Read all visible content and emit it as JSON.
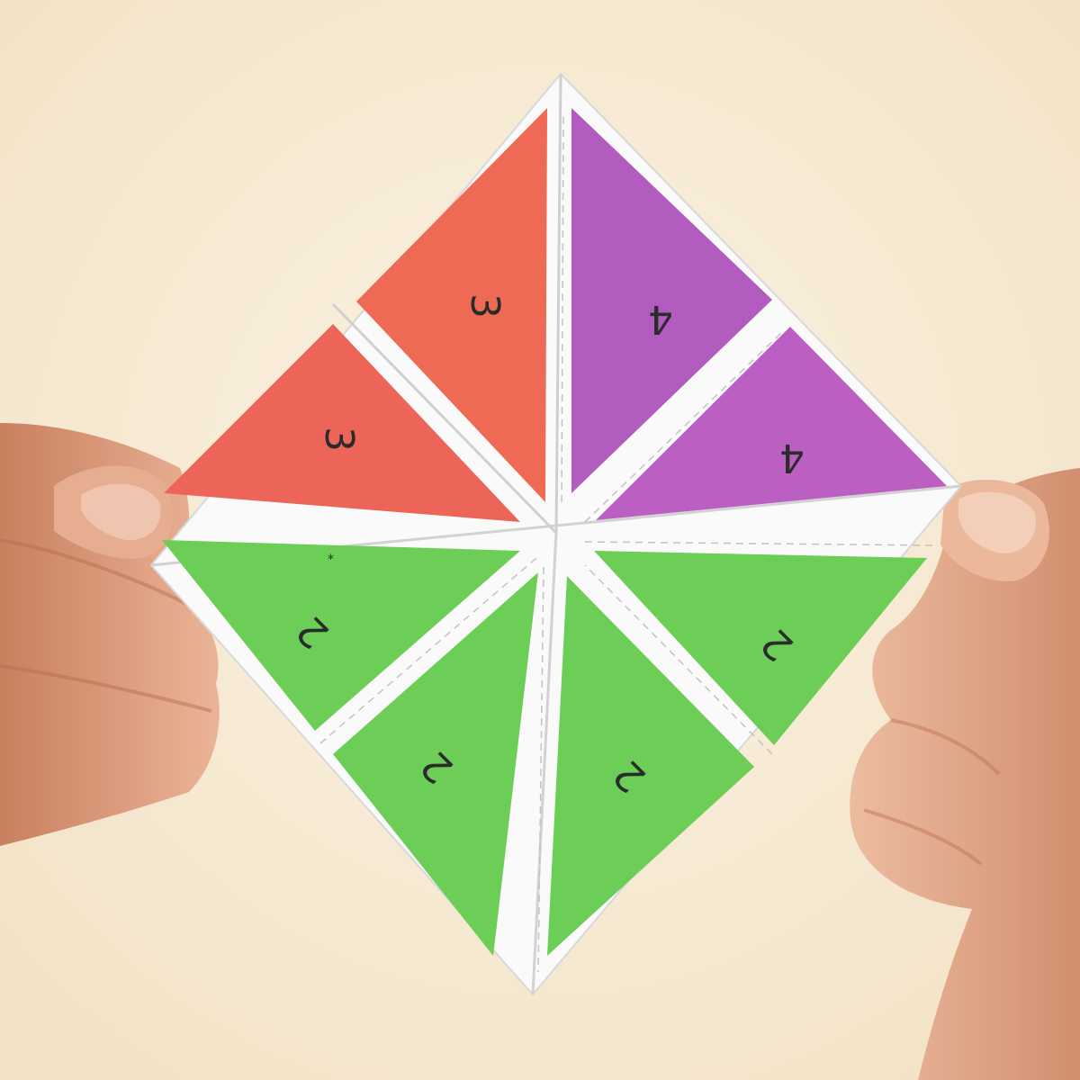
{
  "scene": {
    "subject": "paper-fortune-teller",
    "background_color": "#f6ead4",
    "paper_color": "#fbfafa",
    "crease_color": "#c9c9c9",
    "skin_color": "#e2a584"
  },
  "flaps": [
    {
      "id": "top-left-upper",
      "label": "3",
      "color": "#ef6a55"
    },
    {
      "id": "top-left-lower",
      "label": "3",
      "color": "#ec6558"
    },
    {
      "id": "top-right-upper",
      "label": "4",
      "color": "#b25cc0"
    },
    {
      "id": "top-right-lower",
      "label": "4",
      "color": "#bb5fc2"
    },
    {
      "id": "bottom-left-upper",
      "label": "2",
      "color": "#6ccd57"
    },
    {
      "id": "bottom-left-lower",
      "label": "2",
      "color": "#6ccd57"
    },
    {
      "id": "bottom-right-upper",
      "label": "2",
      "color": "#6ccd57"
    },
    {
      "id": "bottom-right-lower",
      "label": "2",
      "color": "#6ccd57"
    }
  ]
}
